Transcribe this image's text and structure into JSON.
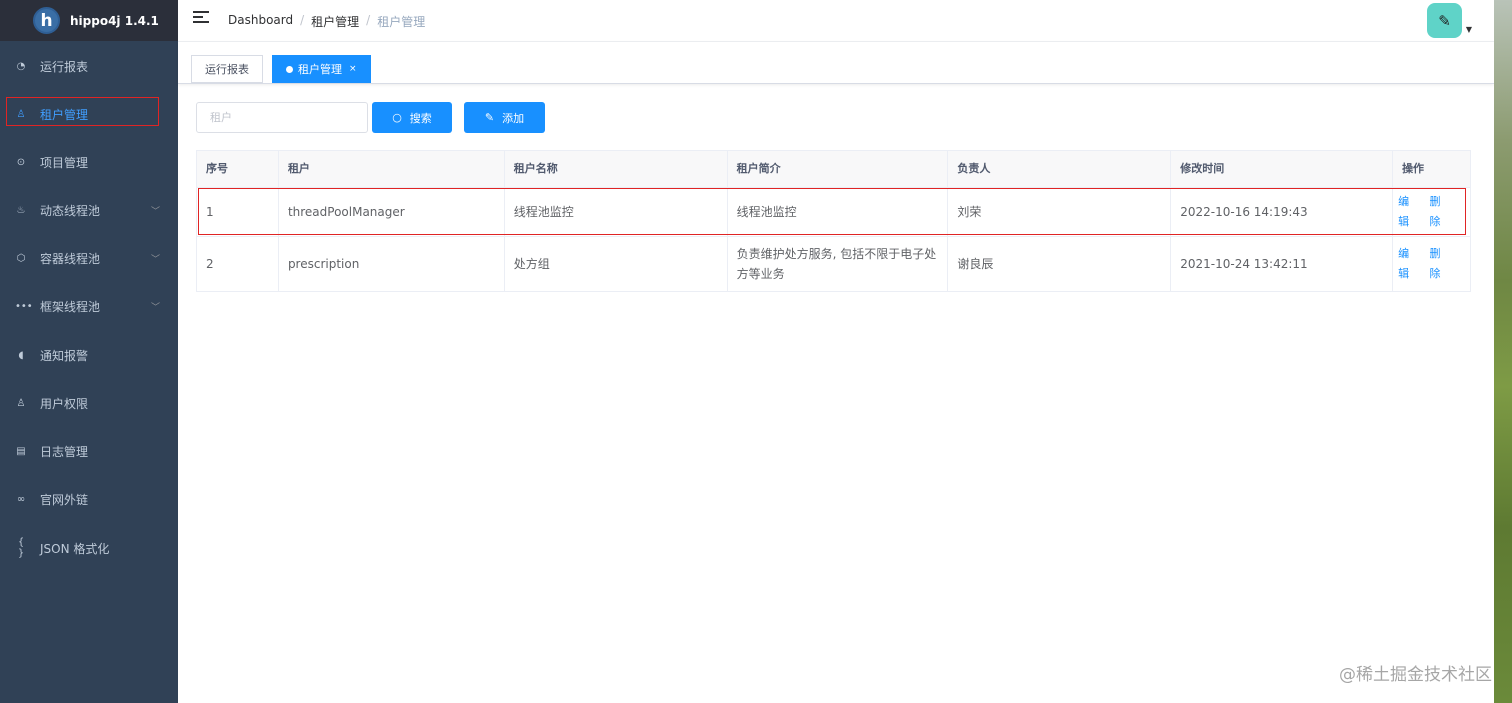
{
  "app": {
    "title": "hippo4j 1.4.1",
    "logo_letter": "h"
  },
  "sidebar": {
    "items": [
      {
        "label": "运行报表",
        "icon": "dashboard-icon",
        "glyph": "◔",
        "expandable": false,
        "active": false
      },
      {
        "label": "租户管理",
        "icon": "user-icon",
        "glyph": "♙",
        "expandable": false,
        "active": true
      },
      {
        "label": "项目管理",
        "icon": "project-icon",
        "glyph": "⊙",
        "expandable": false,
        "active": false
      },
      {
        "label": "动态线程池",
        "icon": "fire-icon",
        "glyph": "♨",
        "expandable": true,
        "active": false
      },
      {
        "label": "容器线程池",
        "icon": "box-icon",
        "glyph": "⬡",
        "expandable": true,
        "active": false
      },
      {
        "label": "框架线程池",
        "icon": "more-icon",
        "glyph": "•••",
        "expandable": true,
        "active": false
      },
      {
        "label": "通知报警",
        "icon": "bell-icon",
        "glyph": "◖",
        "expandable": false,
        "active": false
      },
      {
        "label": "用户权限",
        "icon": "person-icon",
        "glyph": "♙",
        "expandable": false,
        "active": false
      },
      {
        "label": "日志管理",
        "icon": "document-icon",
        "glyph": "▤",
        "expandable": false,
        "active": false
      },
      {
        "label": "官网外链",
        "icon": "link-icon",
        "glyph": "∞",
        "expandable": false,
        "active": false
      },
      {
        "label": "JSON 格式化",
        "icon": "braces-icon",
        "glyph": "{ }",
        "expandable": false,
        "active": false
      }
    ]
  },
  "breadcrumb": [
    "Dashboard",
    "租户管理",
    "租户管理"
  ],
  "tags": [
    {
      "label": "运行报表",
      "active": false
    },
    {
      "label": "租户管理",
      "active": true,
      "close": "×"
    }
  ],
  "filter": {
    "tenant_placeholder": "租户",
    "search_label": "搜索",
    "add_label": "添加"
  },
  "table": {
    "columns": [
      "序号",
      "租户",
      "租户名称",
      "租户简介",
      "负责人",
      "修改时间",
      "操作"
    ],
    "rows": [
      {
        "index": "1",
        "tenant": "threadPoolManager",
        "name": "线程池监控",
        "desc": "线程池监控",
        "owner": "刘荣",
        "modified": "2022-10-16 14:19:43"
      },
      {
        "index": "2",
        "tenant": "prescription",
        "name": "处方组",
        "desc": "负责维护处方服务, 包括不限于电子处方等业务",
        "owner": "谢良辰",
        "modified": "2021-10-24 13:42:11"
      }
    ],
    "actions": {
      "edit": "编辑",
      "delete": "删除"
    }
  },
  "watermark": "@稀土掘金技术社区",
  "colors": {
    "sidebar_bg": "#304156",
    "accent": "#1890ff",
    "highlight": "#e02424"
  }
}
